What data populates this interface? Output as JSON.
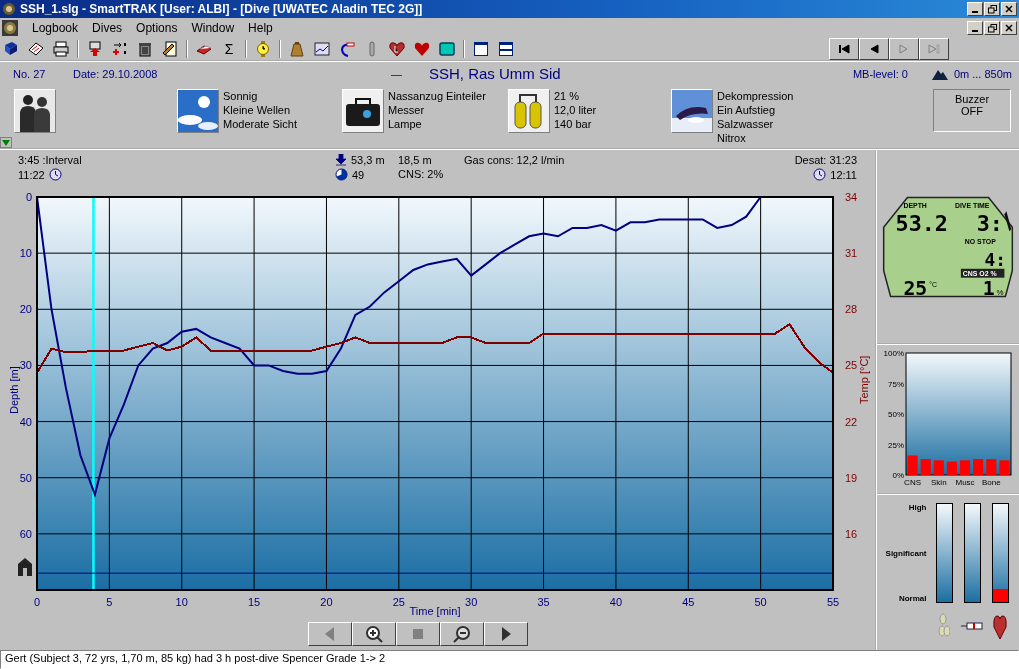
{
  "window": {
    "title": "SSH_1.slg - SmartTRAK  [User: ALBI] - [Dive  [UWATEC Aladin TEC 2G]]"
  },
  "menu": [
    "Logbook",
    "Dives",
    "Options",
    "Window",
    "Help"
  ],
  "toolbar": [
    {
      "kind": "book"
    },
    {
      "kind": "notebook"
    },
    {
      "kind": "printer"
    },
    {
      "kind": "separator"
    },
    {
      "kind": "upload"
    },
    {
      "kind": "import"
    },
    {
      "kind": "trash"
    },
    {
      "kind": "edit"
    },
    {
      "kind": "separator"
    },
    {
      "kind": "eraser"
    },
    {
      "kind": "sum",
      "glyph": "Σ"
    },
    {
      "kind": "separator"
    },
    {
      "kind": "watch"
    },
    {
      "kind": "separator"
    },
    {
      "kind": "weight"
    },
    {
      "kind": "graph"
    },
    {
      "kind": "curve"
    },
    {
      "kind": "pin"
    },
    {
      "kind": "heart-outline"
    },
    {
      "kind": "heart"
    },
    {
      "kind": "screen"
    },
    {
      "kind": "separator"
    },
    {
      "kind": "window"
    },
    {
      "kind": "window-split"
    }
  ],
  "nav_buttons": [
    {
      "kind": "first",
      "disabled": false
    },
    {
      "kind": "back",
      "disabled": false
    },
    {
      "kind": "forward",
      "disabled": true
    },
    {
      "kind": "last",
      "disabled": true
    }
  ],
  "dive_header": {
    "number": "No. 27",
    "date": "Date: 29.10.2008",
    "dash": "—",
    "site": "SSH, Ras Umm Sid",
    "mb_level": "MB-level: 0",
    "altitude": "0m ... 850m"
  },
  "info_groups": [
    {
      "kind": "divers"
    },
    {
      "kind": "weather",
      "lines": [
        "Sonnig",
        "Kleine Wellen",
        "Moderate Sicht"
      ]
    },
    {
      "kind": "equipment",
      "lines": [
        "Nassanzug Einteiler",
        "Messer",
        "Lampe"
      ]
    },
    {
      "kind": "gas",
      "lines": [
        "21 %",
        "12,0 liter",
        "140 bar"
      ]
    },
    {
      "kind": "deco",
      "lines": [
        "Dekompression",
        "Ein Aufstieg",
        "Salzwasser",
        "Nitrox"
      ]
    }
  ],
  "buzzer": {
    "label": "Buzzer",
    "value": "OFF"
  },
  "stats": {
    "interval": "3:45 :Interval",
    "start_time": "11:22",
    "max_depth": "53,3 m",
    "avg_depth": "18,5 m",
    "gas_cons": "Gas cons: 12,2 l/min",
    "duration": "49",
    "cns": "CNS:  2%",
    "desat": "Desat: 31:23",
    "end_time": "12:11"
  },
  "profile": {
    "chart_data": {
      "type": "line",
      "xlabel": "Time [min]",
      "ylabel": "Depth [m]",
      "y2label": "Temp [°C]",
      "x": [
        0,
        1,
        2,
        3,
        4,
        5,
        6,
        7,
        8,
        9,
        10,
        11,
        12,
        13,
        14,
        15,
        16,
        17,
        18,
        19,
        20,
        21,
        22,
        23,
        24,
        25,
        26,
        27,
        28,
        29,
        30,
        31,
        32,
        33,
        34,
        35,
        36,
        37,
        38,
        39,
        40,
        41,
        42,
        43,
        44,
        45,
        46,
        47,
        48,
        49,
        50,
        51,
        52,
        53,
        54,
        55
      ],
      "series": [
        {
          "color": "#000080",
          "values": [
            0,
            20,
            34,
            46,
            53,
            43,
            37,
            30,
            27,
            26,
            24,
            23.5,
            25,
            26,
            27,
            30,
            30,
            31,
            31.5,
            31.5,
            31,
            27,
            21,
            19.5,
            17,
            15,
            13,
            12,
            11.5,
            11,
            14,
            12,
            10,
            8.5,
            7,
            6.5,
            7,
            5.5,
            5.5,
            5,
            6,
            4.5,
            4.5,
            4,
            4,
            4,
            4,
            5.5,
            5,
            3.5,
            0,
            null,
            null,
            null,
            null,
            null
          ]
        },
        {
          "color": "#800000",
          "axis": "y2",
          "values": [
            24.6,
            25.9,
            25.7,
            25.7,
            25.8,
            25.8,
            25.8,
            26,
            26.2,
            25.8,
            26,
            26.5,
            25.8,
            25.8,
            25.8,
            25.8,
            25.8,
            25.8,
            25.8,
            25.8,
            26,
            26.2,
            26.5,
            26.2,
            26.2,
            26.2,
            26.2,
            26.2,
            26.2,
            26.5,
            26.5,
            26.2,
            26.2,
            26.2,
            26.2,
            26.7,
            26.7,
            26.7,
            26.7,
            26.7,
            26.7,
            26.7,
            26.7,
            26.7,
            26.7,
            26.7,
            26.7,
            26.7,
            26.7,
            26.7,
            26.7,
            26.7,
            27.2,
            26,
            25.2,
            24.6
          ]
        }
      ],
      "xlim": [
        0,
        55
      ],
      "ylim": [
        70,
        0
      ],
      "y2lim": [
        13,
        34
      ],
      "xticks": [
        0,
        5,
        10,
        15,
        20,
        25,
        30,
        35,
        40,
        45,
        50,
        55
      ],
      "yticks": [
        0,
        10,
        20,
        30,
        40,
        50,
        60
      ],
      "y2ticks": [
        16,
        19,
        22,
        25,
        28,
        31,
        34
      ],
      "grid": true,
      "ref_lines": [
        {
          "axis": "x",
          "value": 3.9,
          "color": "#00ffff"
        },
        {
          "axis": "y",
          "value": 67,
          "color": "#000080"
        }
      ]
    }
  },
  "computer": {
    "depth_label": "DEPTH",
    "depth": "53.2",
    "time_label": "DIVE TIME",
    "time": "3:",
    "nostop_label": "NO STOP",
    "nostop": "4:",
    "cns_label": "CNS O2 %",
    "temp": "25",
    "temp_unit": "°C",
    "cns": "1",
    "cns_unit": "%"
  },
  "saturation": {
    "chart_data": {
      "type": "bar",
      "categories": [
        "CNS",
        null,
        "Skin",
        null,
        "Musc",
        null,
        "Bone",
        null
      ],
      "values": [
        16,
        13,
        12,
        11,
        12,
        13,
        13,
        12
      ],
      "ylim": [
        0,
        100
      ],
      "yticks": [
        {
          "value": 0,
          "label": "0%"
        },
        {
          "value": 25,
          "label": "25%"
        },
        {
          "value": 50,
          "label": "50%"
        },
        {
          "value": 75,
          "label": "75%"
        },
        {
          "value": 100,
          "label": "100%"
        }
      ]
    }
  },
  "risk_gauges": {
    "scale": [
      "High",
      "Significant",
      "Normal"
    ],
    "gauges": [
      {
        "kind": "lungs"
      },
      {
        "kind": "syringe"
      },
      {
        "kind": "heart",
        "level": 0.13
      }
    ]
  },
  "playback_buttons": [
    {
      "kind": "back",
      "disabled": true
    },
    {
      "kind": "zoom-in",
      "disabled": false
    },
    {
      "kind": "stop",
      "disabled": true
    },
    {
      "kind": "zoom-out",
      "disabled": false
    },
    {
      "kind": "forward",
      "disabled": false
    }
  ],
  "status_bar": "Gert (Subject 3, 72 yrs, 1,70 m, 85 kg) had 3 h post-dive Spencer Grade 1-> 2"
}
